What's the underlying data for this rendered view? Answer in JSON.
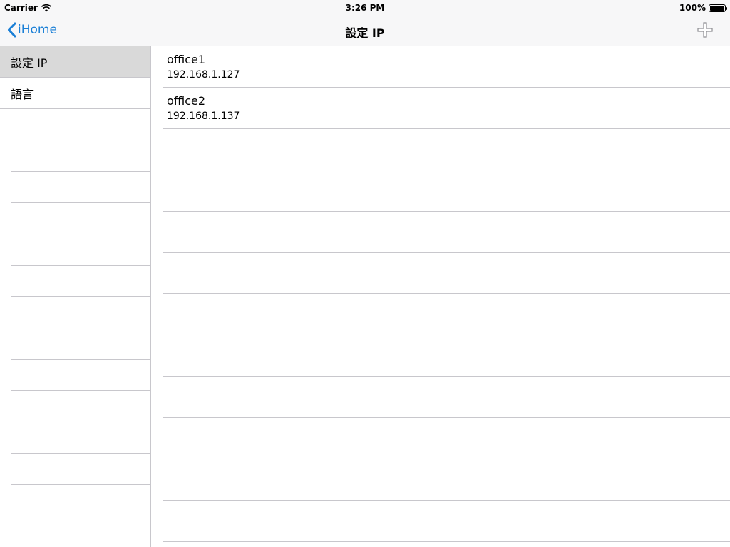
{
  "status_bar": {
    "carrier": "Carrier",
    "time": "3:26 PM",
    "battery": "100%",
    "battery_level": 1.0
  },
  "nav": {
    "back_label": "iHome",
    "title": "設定 IP",
    "add_icon": "plus-icon"
  },
  "sidebar": {
    "items": [
      {
        "label": "設定 IP",
        "selected": true
      },
      {
        "label": "語言",
        "selected": false
      }
    ]
  },
  "ip_list": {
    "rows": [
      {
        "name": "office1",
        "address": "192.168.1.127"
      },
      {
        "name": "office2",
        "address": "192.168.1.137"
      }
    ]
  },
  "colors": {
    "accent": "#1a7fd6",
    "selected_row": "#d9d9d9",
    "separator": "#c8c7cc"
  }
}
